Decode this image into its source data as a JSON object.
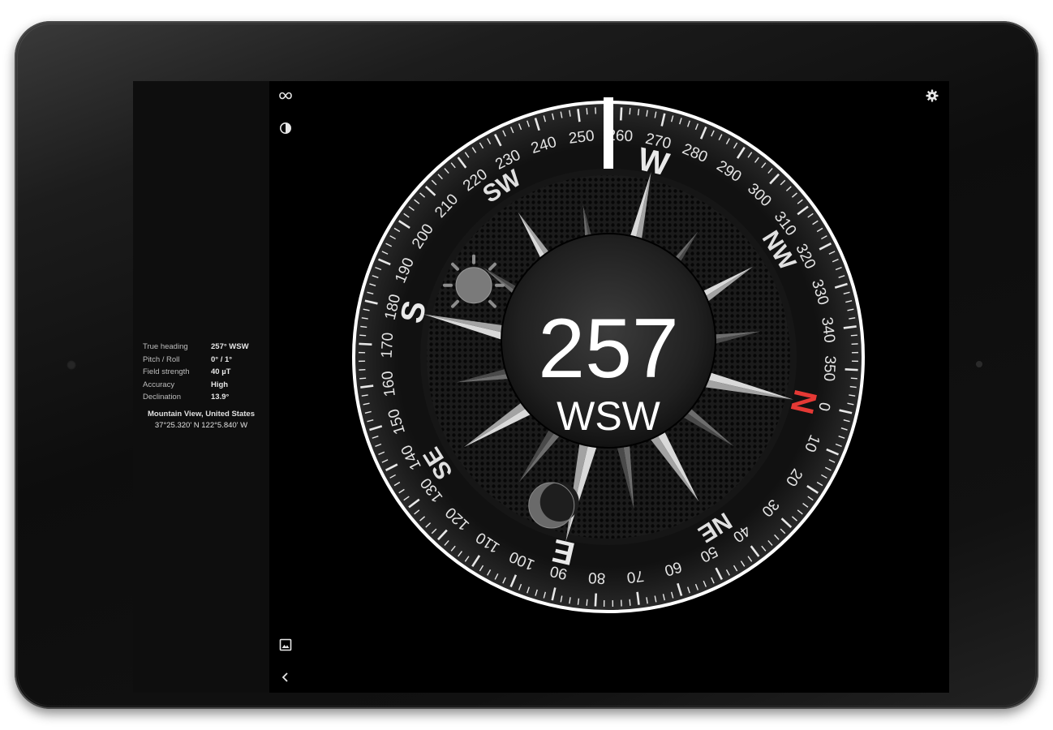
{
  "info": {
    "rows": [
      {
        "label": "True heading",
        "value": "257° WSW"
      },
      {
        "label": "Pitch / Roll",
        "value": "0° / 1°"
      },
      {
        "label": "Field strength",
        "value": "40 µT"
      },
      {
        "label": "Accuracy",
        "value": "High"
      },
      {
        "label": "Declination",
        "value": "13.9°"
      }
    ],
    "location_name": "Mountain View, United States",
    "coordinates": "37°25.320' N 122°5.840' W"
  },
  "compass": {
    "heading": 257,
    "heading_label": "257",
    "direction_label": "WSW",
    "cardinals": {
      "N": "N",
      "E": "E",
      "S": "S",
      "W": "W"
    },
    "intercardinals": {
      "NE": "NE",
      "SE": "SE",
      "SW": "SW",
      "NW": "NW"
    },
    "north_color": "#e53935"
  },
  "toolbar": {
    "icons": [
      "infinity-icon",
      "contrast-icon",
      "gear-icon",
      "image-icon",
      "chevron-left-icon"
    ]
  }
}
